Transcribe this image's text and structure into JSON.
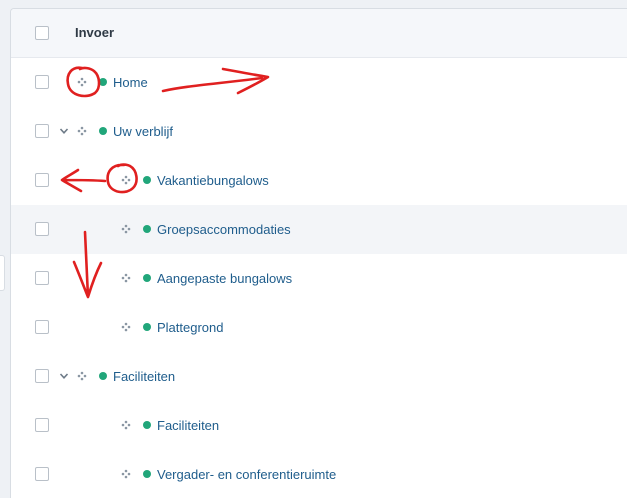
{
  "table": {
    "header_label": "Invoer",
    "rows": [
      {
        "label": "Home",
        "level": 0,
        "expandable": false,
        "status_color": "#21a67a"
      },
      {
        "label": "Uw verblijf",
        "level": 0,
        "expandable": true,
        "status_color": "#21a67a"
      },
      {
        "label": "Vakantiebungalows",
        "level": 1,
        "expandable": false,
        "status_color": "#21a67a"
      },
      {
        "label": "Groepsaccommodaties",
        "level": 1,
        "expandable": false,
        "status_color": "#21a67a"
      },
      {
        "label": "Aangepaste bungalows",
        "level": 1,
        "expandable": false,
        "status_color": "#21a67a"
      },
      {
        "label": "Plattegrond",
        "level": 1,
        "expandable": false,
        "status_color": "#21a67a"
      },
      {
        "label": "Faciliteiten",
        "level": 0,
        "expandable": true,
        "status_color": "#21a67a"
      },
      {
        "label": "Faciliteiten",
        "level": 1,
        "expandable": false,
        "status_color": "#21a67a"
      },
      {
        "label": "Vergader- en conferentieruimte",
        "level": 1,
        "expandable": false,
        "status_color": "#21a67a"
      }
    ]
  },
  "annotations": {
    "ink_color": "#e02020",
    "marks": [
      "circle-around-drag-handle-home",
      "arrow-right-from-home",
      "circle-around-drag-handle-vakantiebungalows",
      "arrow-left-from-vakantiebungalows",
      "arrow-down"
    ]
  },
  "icons": {
    "drag": "drag-handle-icon",
    "expand": "chevron-down-icon",
    "status": "status-dot-icon"
  }
}
